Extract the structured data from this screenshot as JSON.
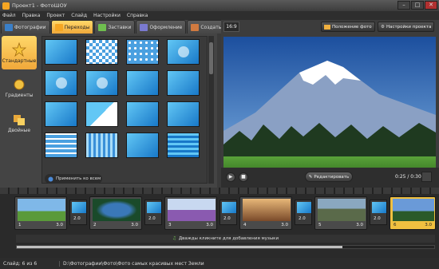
{
  "window": {
    "title": "Проект1 - ФотоШОУ",
    "minimize": "–",
    "maximize": "□",
    "close": "✕"
  },
  "menu": [
    "Файл",
    "Правка",
    "Проект",
    "Слайд",
    "Настройки",
    "Справка"
  ],
  "tabs": [
    {
      "label": "Фотографии",
      "color": "#3a7fc8"
    },
    {
      "label": "Переходы",
      "color": "#f5a623",
      "active": true
    },
    {
      "label": "Заставки",
      "color": "#6fbf4f"
    },
    {
      "label": "Оформление",
      "color": "#7a7ad0"
    },
    {
      "label": "Создать",
      "color": "#d07a40"
    }
  ],
  "side_buttons": [
    {
      "label": "Стандартные",
      "active": true
    },
    {
      "label": "Градиенты",
      "active": false
    },
    {
      "label": "Двойные",
      "active": false
    }
  ],
  "apply_all": "Применить ко всем",
  "preview_toolbar": {
    "ratio": "16:9",
    "position": "Положение фото",
    "settings": "Настройки проекта"
  },
  "controls": {
    "edit": "Редактировать",
    "time": "0:25 / 0:30"
  },
  "slides": [
    {
      "num": "1",
      "dur": "3.0",
      "colors": [
        "#7fb8e8",
        "#5a9a3a"
      ]
    },
    {
      "num": "2",
      "dur": "3.0",
      "colors": [
        "#3a78b8",
        "#1a4a2a"
      ]
    },
    {
      "num": "3",
      "dur": "3.0",
      "colors": [
        "#c8d8f0",
        "#8a5ab0"
      ]
    },
    {
      "num": "4",
      "dur": "3.0",
      "colors": [
        "#e8b878",
        "#7a4a2a"
      ]
    },
    {
      "num": "5",
      "dur": "3.0",
      "colors": [
        "#8aa8c0",
        "#5a6a4a"
      ]
    },
    {
      "num": "6",
      "dur": "3.0",
      "colors": [
        "#6a9ad8",
        "#2a5a2a"
      ]
    }
  ],
  "transitions": [
    {
      "dur": "2.0"
    },
    {
      "dur": "2.0"
    },
    {
      "dur": "2.0"
    },
    {
      "dur": "2.0"
    },
    {
      "dur": "2.0"
    }
  ],
  "music_hint": "Дважды кликните для добавления музыки",
  "timeline_progress": 0.78,
  "status": {
    "slide": "Слайд: 6 из 6",
    "path": "D:\\Фотографии\\Фото\\Фото самых красивых мест Земли"
  }
}
